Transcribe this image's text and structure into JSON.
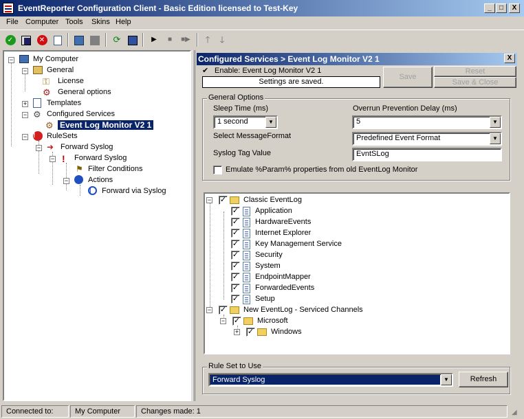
{
  "window": {
    "title": "EventReporter Configuration Client - Basic Edition licensed to Test-Key",
    "minimize": "_",
    "maximize": "□",
    "close": "X"
  },
  "menu": [
    "File",
    "Computer",
    "Tools",
    "Skins",
    "Help"
  ],
  "toolbar": {
    "icons": [
      "ok-icon",
      "save-icon",
      "cancel-icon",
      "edit-icon",
      "service-icon",
      "stop-square-icon",
      "refresh-icon",
      "save-all-icon",
      "play-icon",
      "stop-icon",
      "step-icon",
      "up-arrow-icon",
      "down-arrow-icon"
    ]
  },
  "tree": {
    "root": "My Computer",
    "general": "General",
    "license": "License",
    "general_options": "General options",
    "templates": "Templates",
    "configured_services": "Configured Services",
    "event_log_monitor": "Event Log Monitor V2 1",
    "rulesets": "RuleSets",
    "forward_syslog_rs": "Forward Syslog",
    "forward_syslog_rule": "Forward Syslog",
    "filter_conditions": "Filter Conditions",
    "actions": "Actions",
    "forward_via_syslog": "Forward via Syslog"
  },
  "panel": {
    "header": "Configured Services > Event Log Monitor V2 1",
    "close": "X",
    "enable_label": "Enable: Event Log Monitor V2 1",
    "enable_checked": "✔",
    "status": "Settings are saved.",
    "save": "Save",
    "reset": "Reset",
    "save_close": "Save & Close"
  },
  "general_options": {
    "title": "General Options",
    "sleep_label": "Sleep Time (ms)",
    "sleep_value": "1 second",
    "overrun_label": "Overrun Prevention Delay (ms)",
    "overrun_value": "5",
    "message_format_label": "Select MessageFormat",
    "message_format_value": "Predefined Event Format",
    "syslog_tag_label": "Syslog Tag Value",
    "syslog_tag_value": "EvntSLog",
    "emulate_label": "Emulate %Param% properties from old EventLog Monitor"
  },
  "event_tree": {
    "classic": "Classic EventLog",
    "classic_children": [
      "Application",
      "HardwareEvents",
      "Internet Explorer",
      "Key Management Service",
      "Security",
      "System",
      "EndpointMapper",
      "ForwardedEvents",
      "Setup"
    ],
    "new_eventlog": "New EventLog - Serviced Channels",
    "microsoft": "Microsoft",
    "windows": "Windows"
  },
  "ruleset": {
    "title": "Rule Set to Use",
    "value": "Forward Syslog",
    "refresh": "Refresh"
  },
  "status": {
    "connected_label": "Connected to:",
    "computer": "My Computer",
    "changes": "Changes made: 1"
  }
}
